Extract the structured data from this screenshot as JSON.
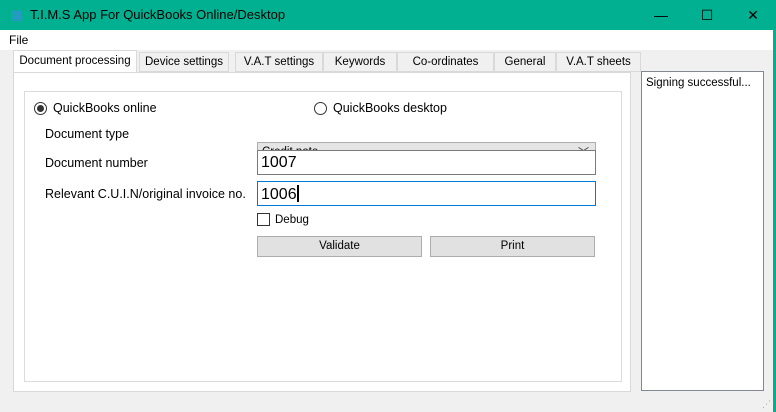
{
  "window": {
    "title": "T.I.M.S App For QuickBooks Online/Desktop",
    "minimize": "—",
    "maximize": "☐",
    "close": "✕"
  },
  "menu": {
    "file": "File"
  },
  "tabs": [
    "Document processing",
    "Device settings",
    "V.A.T settings",
    "Keywords",
    "Co-ordinates",
    "General",
    "V.A.T sheets"
  ],
  "form": {
    "radio_online": "QuickBooks online",
    "radio_desktop": "QuickBooks desktop",
    "selected_mode": "online",
    "document_type_label": "Document type",
    "document_type_value": "Credit note",
    "document_number_label": "Document number",
    "document_number_value": "1007",
    "cuin_label": "Relevant C.U.I.N/original invoice no.",
    "cuin_value": "1006",
    "debug_label": "Debug",
    "debug_checked": false,
    "validate_label": "Validate",
    "print_label": "Print"
  },
  "status": {
    "text": "Signing successful..."
  },
  "colors": {
    "titlebar": "#00b090",
    "focus": "#0078d7"
  }
}
